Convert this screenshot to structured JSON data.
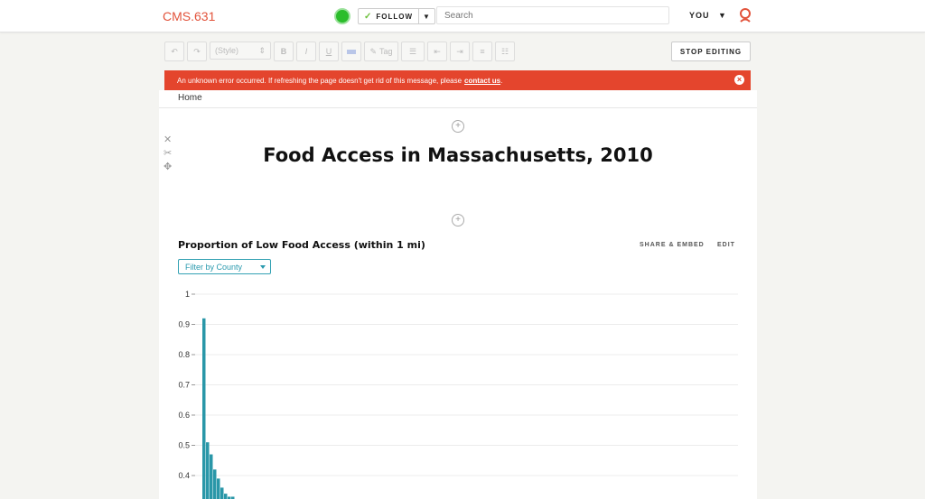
{
  "topbar": {
    "brand": "CMS.631",
    "follow_label": "FOLLOW",
    "follow_caret": "▼",
    "search_placeholder": "Search",
    "user_label": "YOU",
    "user_caret": "▼"
  },
  "toolbar": {
    "undo": "↶",
    "redo": "↷",
    "style_select": "(Style)",
    "bold": "B",
    "italic": "I",
    "underline": "U",
    "tag": "Tag",
    "stop_editing": "STOP EDITING"
  },
  "error": {
    "message": "An unknown error occurred. If refreshing the page doesn't get rid of this message, please",
    "link": "contact us",
    "suffix": ".",
    "close": "×"
  },
  "breadcrumb": "Home",
  "page": {
    "title": "Food Access in Massachusetts, 2010",
    "side_tools": [
      "✕",
      "✂",
      "✥"
    ],
    "add_symbol": "+"
  },
  "chart_section": {
    "title": "Proportion of Low Food Access (within 1 mi)",
    "share_label": "SHARE & EMBED",
    "edit_label": "EDIT",
    "filter_label": "Filter by County"
  },
  "colors": {
    "brand": "#e2533b",
    "error_bg": "#e4452d",
    "bar": "#2a97a8",
    "filter": "#33a1b3"
  },
  "chart_data": {
    "type": "bar",
    "title": "Proportion of Low Food Access (within 1 mi)",
    "xlabel": "",
    "ylabel": "",
    "ylim": [
      0.32,
      1
    ],
    "y_ticks": [
      1,
      0.9,
      0.8,
      0.7,
      0.6,
      0.5,
      0.4
    ],
    "y_tick_labels": [
      "1",
      "0.9",
      "0.8",
      "0.7",
      "0.6",
      "0.5",
      "0.4"
    ],
    "grid": true,
    "values": [
      0.92,
      0.51,
      0.47,
      0.42,
      0.39,
      0.36,
      0.34,
      0.33,
      0.33
    ]
  }
}
